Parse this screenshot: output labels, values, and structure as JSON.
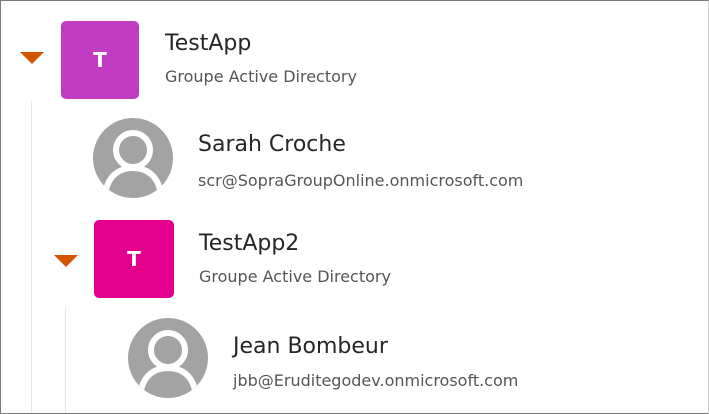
{
  "tree": {
    "group1": {
      "initial": "T",
      "name": "TestApp",
      "type": "Groupe Active Directory",
      "color": "#c13bc1",
      "expanded": true,
      "members": {
        "user1": {
          "name": "Sarah Croche",
          "email": "scr@SopraGroupOnline.onmicrosoft.com"
        },
        "group2": {
          "initial": "T",
          "name": "TestApp2",
          "type": "Groupe Active Directory",
          "color": "#e3008c",
          "expanded": true,
          "members": {
            "user2": {
              "name": "Jean Bombeur",
              "email": "jbb@Eruditegodev.onmicrosoft.com"
            }
          }
        }
      }
    }
  },
  "colors": {
    "caret": "#d35400",
    "avatar_bg": "#a3a3a3",
    "avatar_fg": "#ffffff",
    "guide_line": "#e6e6e6"
  }
}
